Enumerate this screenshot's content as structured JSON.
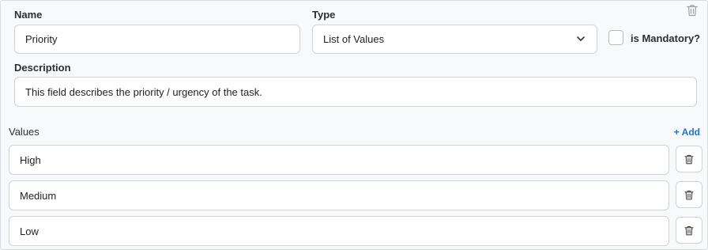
{
  "form": {
    "name_label": "Name",
    "name_value": "Priority",
    "type_label": "Type",
    "type_value": "List of Values",
    "mandatory_label": "is Mandatory?",
    "mandatory_checked": false,
    "description_label": "Description",
    "description_value": "This field describes the priority / urgency of the task."
  },
  "values_section": {
    "label": "Values",
    "add_label": "+ Add",
    "items": [
      {
        "value": "High"
      },
      {
        "value": "Medium"
      },
      {
        "value": "Low"
      }
    ]
  },
  "icons": {
    "delete": "trash-icon",
    "dropdown": "chevron-down-icon"
  },
  "colors": {
    "accent": "#1f6fd1",
    "border": "#cfd3d8",
    "panel": "#f8f9fb"
  }
}
